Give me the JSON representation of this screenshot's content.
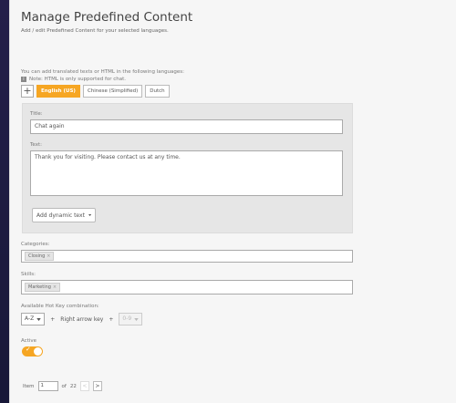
{
  "header": {
    "title": "Manage Predefined Content",
    "subtitle": "Add / edit Predefined Content for your selected languages."
  },
  "languages": {
    "info": "You can add translated texts or HTML in the following languages:",
    "note_icon": "i",
    "note": "Note: HTML is only supported for chat.",
    "add_label": "+",
    "tabs": [
      {
        "label": "English (US)",
        "active": true
      },
      {
        "label": "Chinese (Simplified)",
        "active": false
      },
      {
        "label": "Dutch",
        "active": false
      }
    ]
  },
  "form": {
    "title_label": "Title:",
    "title_value": "Chat again",
    "text_label": "Text:",
    "text_value": "Thank you for visiting. Please contact us at any time.",
    "dynamic_button": "Add dynamic text",
    "chevron_icon": "chevron-down-icon"
  },
  "categories": {
    "label": "Categories:",
    "tags": [
      {
        "label": "Closing",
        "remove": "×"
      }
    ]
  },
  "skills": {
    "label": "Skills:",
    "tags": [
      {
        "label": "Marketing",
        "remove": "×"
      }
    ]
  },
  "hotkey": {
    "label": "Available Hot Key combination:",
    "modifier": "A-Z",
    "separator1": "+",
    "key": "Right arrow key",
    "separator2": "+",
    "number": "0-9"
  },
  "active": {
    "label": "Active",
    "enabled": true,
    "check": "✓"
  },
  "pager": {
    "item_label": "Item",
    "current": "1",
    "of_label": "of",
    "total": "22",
    "prev": "<",
    "next": ">"
  },
  "colors": {
    "accent": "#f6a623",
    "panel_bg": "#f6f6f6",
    "box_bg": "#e6e6e6"
  }
}
